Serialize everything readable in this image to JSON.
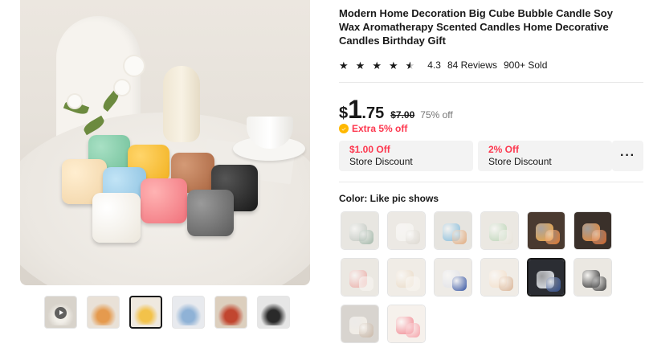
{
  "product": {
    "title": "Modern Home Decoration Big Cube Bubble Candle Soy Wax Aromatherapy Scented Candles Home Decorative Candles Birthday Gift",
    "rating": "4.3",
    "rating_stars": 4.3,
    "reviews": "84 Reviews",
    "sold": "900+ Sold"
  },
  "price": {
    "currency": "$",
    "integer": "1",
    "decimal": ".75",
    "original": "$7.00",
    "discount": "75% off",
    "extra": "Extra 5% off"
  },
  "coupons": [
    {
      "amount": "$1.00 Off",
      "label": "Store Discount"
    },
    {
      "amount": "2% Off",
      "label": "Store Discount"
    }
  ],
  "more_label": "···",
  "color": {
    "label": "Color: Like pic shows",
    "selected_index": 10
  },
  "swatch_colors": [
    [
      "#e8e6e1",
      "#bfc5be",
      "#9fb5a6"
    ],
    [
      "#ece9e4",
      "#f4f2ee",
      "#dcd8d0"
    ],
    [
      "#e6e4df",
      "#7fb8d9",
      "#e0a97b"
    ],
    [
      "#ebe8e2",
      "#b9d3b4",
      "#e6e2d8"
    ],
    [
      "#4a3a30",
      "#f1a43a",
      "#e27b30"
    ],
    [
      "#3a302a",
      "#e8842e",
      "#d4662a"
    ],
    [
      "#ebe8e2",
      "#e9a8a2",
      "#f3f0ea"
    ],
    [
      "#f0ece6",
      "#e9d9c4",
      "#f5f1ea"
    ],
    [
      "#eeebe6",
      "#dfe0e6",
      "#2f4fa0"
    ],
    [
      "#f0ece6",
      "#f2ddc7",
      "#d9b394"
    ],
    [
      "#2b2d33",
      "#e8edf3",
      "#2d4b8c"
    ],
    [
      "#ebe8e2",
      "#222222",
      "#3a3a3a"
    ],
    [
      "#d8d4cf",
      "#f2ece4",
      "#c9b7a6"
    ],
    [
      "#f6f1ec",
      "#f0808a",
      "#f6a1a8"
    ]
  ],
  "thumbnails": [
    {
      "colors": [
        "#d8d3cb",
        "#f2efe9"
      ],
      "video": true
    },
    {
      "colors": [
        "#e9e1d7",
        "#e59a4e"
      ],
      "video": false
    },
    {
      "colors": [
        "#efe9df",
        "#f3c24a"
      ],
      "video": false
    },
    {
      "colors": [
        "#e8eaee",
        "#8fb2d6"
      ],
      "video": false
    },
    {
      "colors": [
        "#dccfbe",
        "#c1462f"
      ],
      "video": false
    },
    {
      "colors": [
        "#e6e6e6",
        "#2a2a2a"
      ],
      "video": false
    }
  ],
  "active_thumbnail": 2
}
